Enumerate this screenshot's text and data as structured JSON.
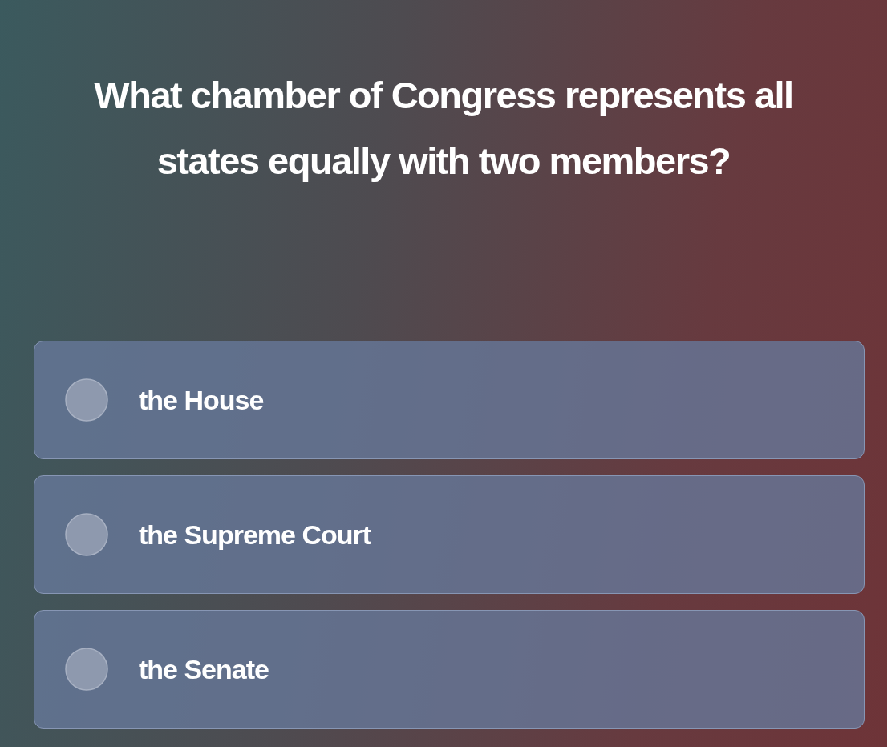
{
  "question": "What chamber of Congress represents all states equally with two members?",
  "options": [
    {
      "label": "the House",
      "selected": false
    },
    {
      "label": "the Supreme Court",
      "selected": false
    },
    {
      "label": "the Senate",
      "selected": false
    }
  ]
}
